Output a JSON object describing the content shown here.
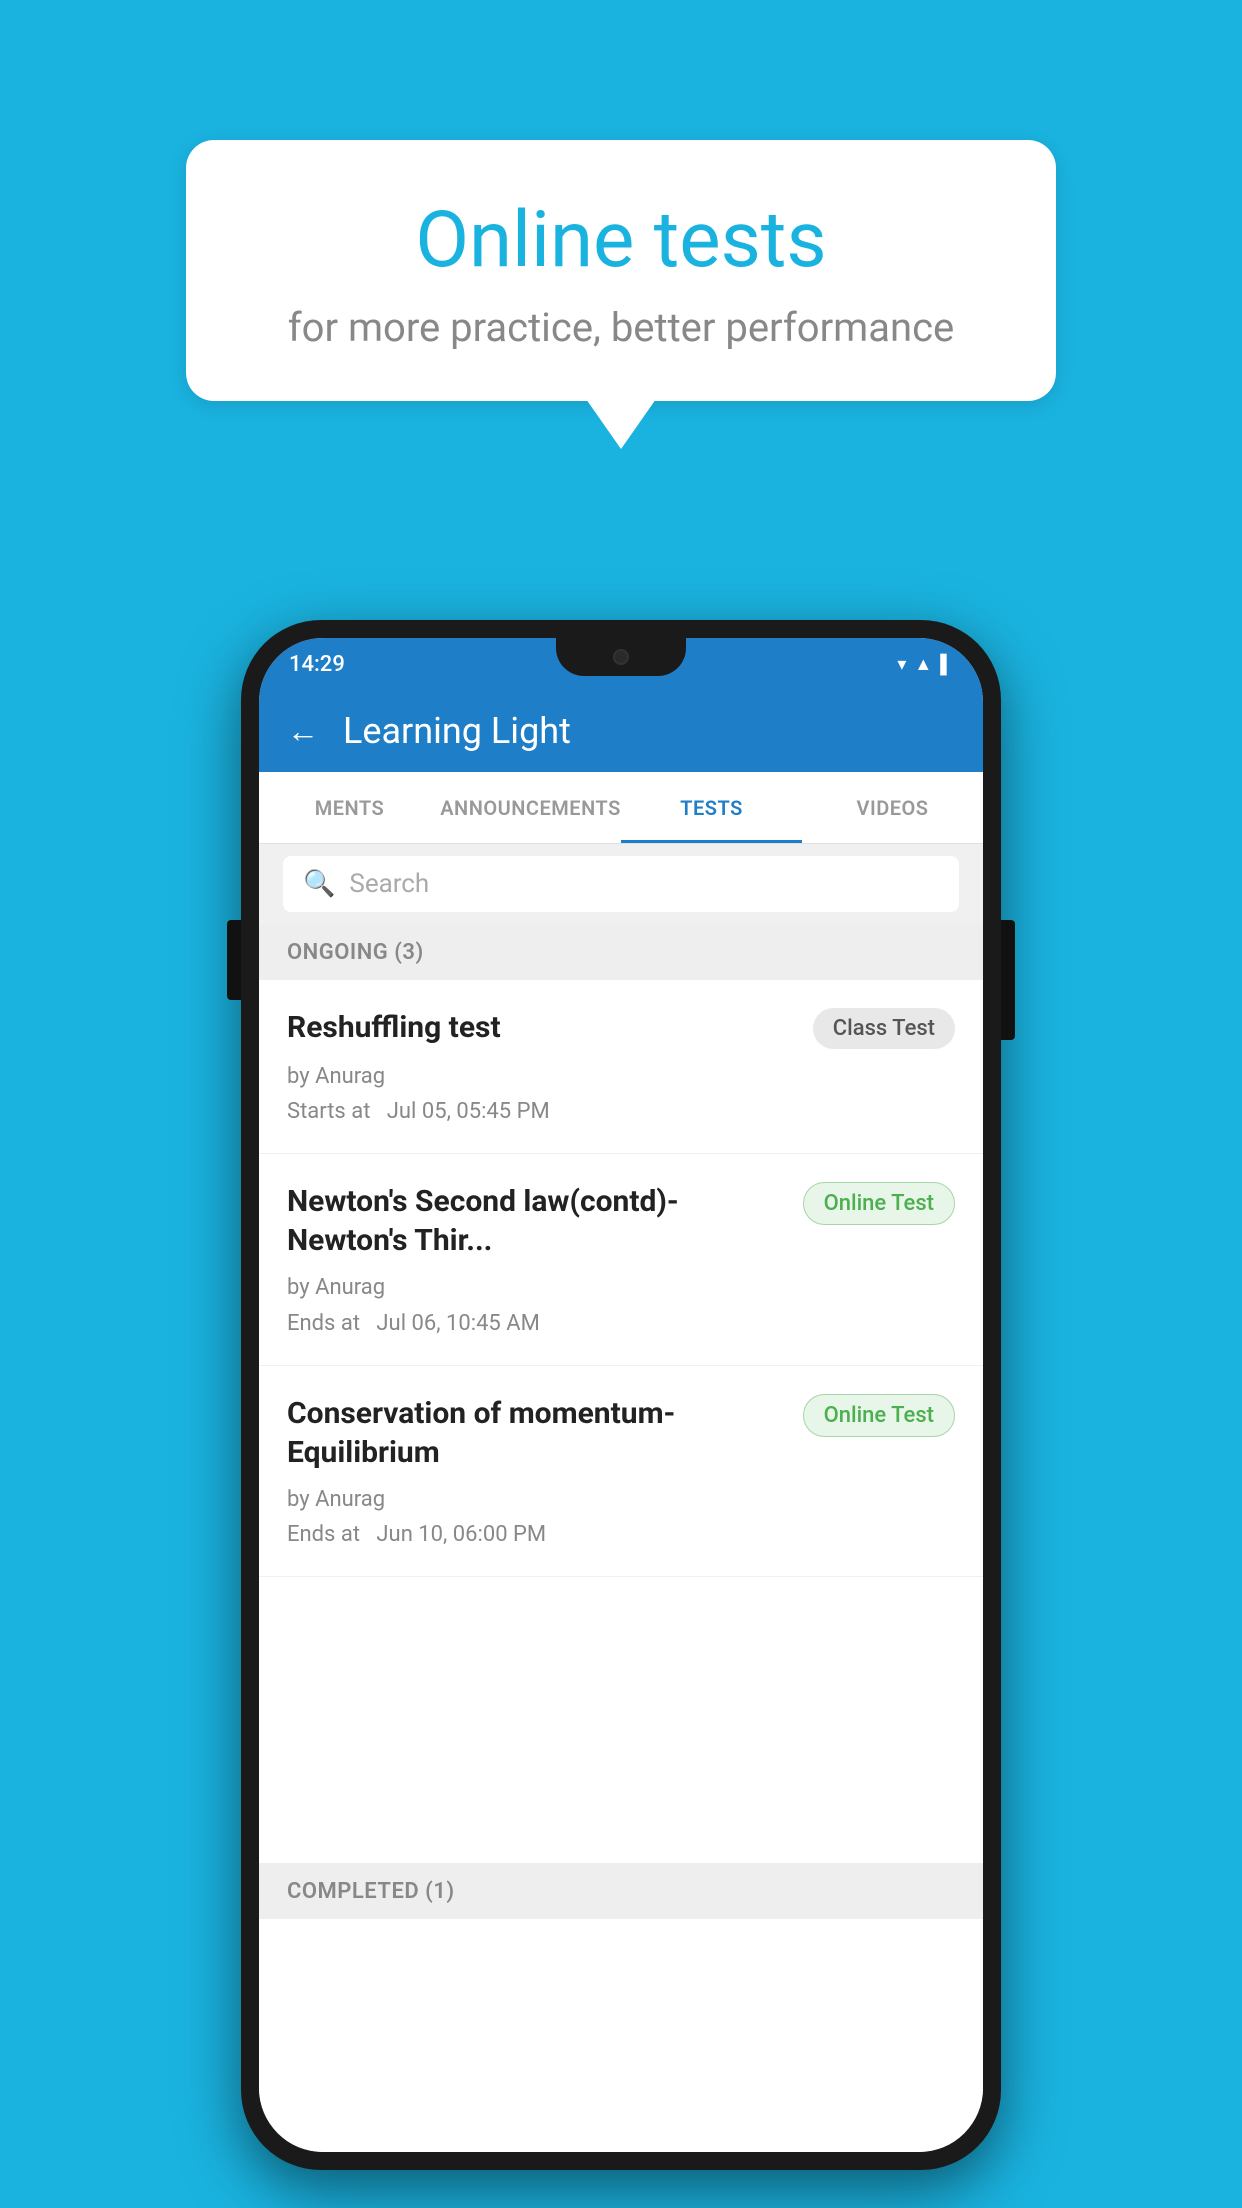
{
  "background_color": "#1ab3e0",
  "speech_bubble": {
    "title": "Online tests",
    "subtitle": "for more practice, better performance"
  },
  "phone": {
    "status_bar": {
      "time": "14:29",
      "icons": [
        "wifi",
        "signal",
        "battery"
      ]
    },
    "header": {
      "back_label": "←",
      "title": "Learning Light"
    },
    "tabs": [
      {
        "label": "MENTS",
        "active": false
      },
      {
        "label": "ANNOUNCEMENTS",
        "active": false
      },
      {
        "label": "TESTS",
        "active": true
      },
      {
        "label": "VIDEOS",
        "active": false
      }
    ],
    "search": {
      "placeholder": "Search"
    },
    "sections": [
      {
        "label": "ONGOING (3)",
        "tests": [
          {
            "name": "Reshuffling test",
            "badge": "Class Test",
            "badge_type": "class",
            "by": "by Anurag",
            "time_label": "Starts at",
            "time": "Jul 05, 05:45 PM"
          },
          {
            "name": "Newton's Second law(contd)-Newton's Thir...",
            "badge": "Online Test",
            "badge_type": "online",
            "by": "by Anurag",
            "time_label": "Ends at",
            "time": "Jul 06, 10:45 AM"
          },
          {
            "name": "Conservation of momentum-Equilibrium",
            "badge": "Online Test",
            "badge_type": "online",
            "by": "by Anurag",
            "time_label": "Ends at",
            "time": "Jun 10, 06:00 PM"
          }
        ]
      }
    ],
    "completed_section_label": "COMPLETED (1)"
  }
}
